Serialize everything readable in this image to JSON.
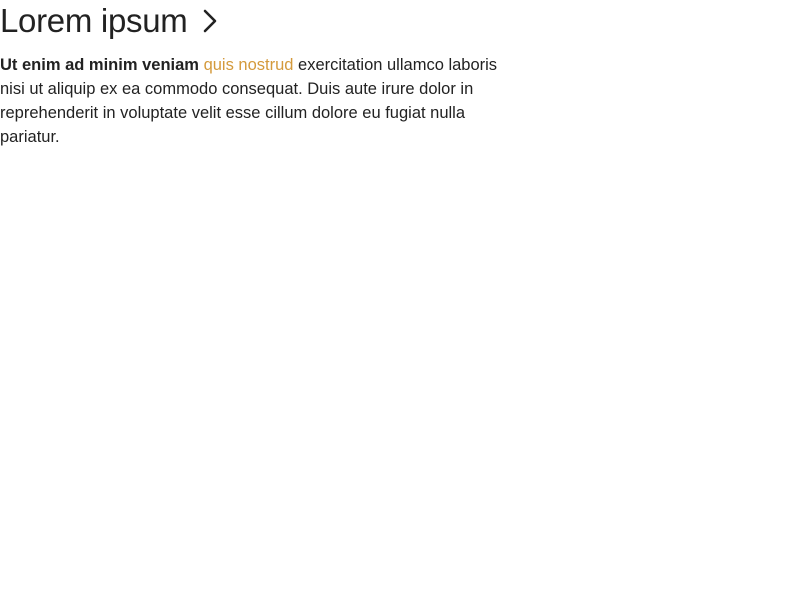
{
  "heading": {
    "title": "Lorem ipsum",
    "icon": "chevron-right-icon"
  },
  "paragraph": {
    "lead": "Ut enim ad minim veniam",
    "link_text": "quis nostrud",
    "rest": "exercitation ullamco laboris nisi ut aliquip ex ea commodo consequat. Duis aute irure dolor in reprehenderit in voluptate velit esse cillum dolore eu fugiat nulla pariatur."
  },
  "colors": {
    "text": "#222222",
    "link": "#d49a3c",
    "background": "#ffffff"
  }
}
